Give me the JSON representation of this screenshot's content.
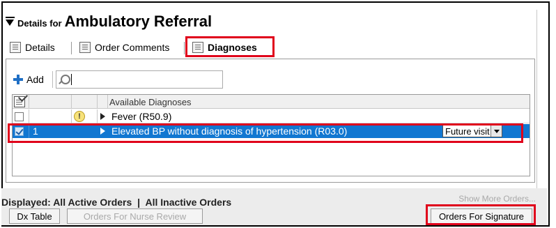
{
  "header": {
    "prefix": "Details for",
    "title": "Ambulatory Referral"
  },
  "tabs": [
    {
      "label": "Details",
      "icon": "details-icon",
      "active": false
    },
    {
      "label": "Order Comments",
      "icon": "comments-icon",
      "active": false
    },
    {
      "label": "Diagnoses",
      "icon": "diagnoses-icon",
      "active": true
    }
  ],
  "toolbar": {
    "add_label": "Add",
    "search_value": ""
  },
  "grid": {
    "column_header": "Available Diagnoses",
    "rows": [
      {
        "checked": false,
        "number": "",
        "warning": "!",
        "diagnosis": "Fever (R50.9)",
        "selected": false
      },
      {
        "checked": true,
        "number": "1",
        "warning": "",
        "diagnosis": "Elevated BP without diagnosis of hypertension (R03.0)",
        "selected": true,
        "dropdown": "Future visit"
      }
    ]
  },
  "footer": {
    "displayed_prefix": "Displayed:",
    "active_orders": "All Active Orders",
    "separator": "|",
    "inactive_orders": "All Inactive Orders",
    "show_more": "Show More Orders...",
    "dx_table": "Dx Table",
    "nurse_review": "Orders For Nurse Review",
    "signature": "Orders For Signature"
  },
  "colors": {
    "highlight": "#e0001b",
    "selection": "#1177d1",
    "add_icon": "#1f6fc5"
  }
}
